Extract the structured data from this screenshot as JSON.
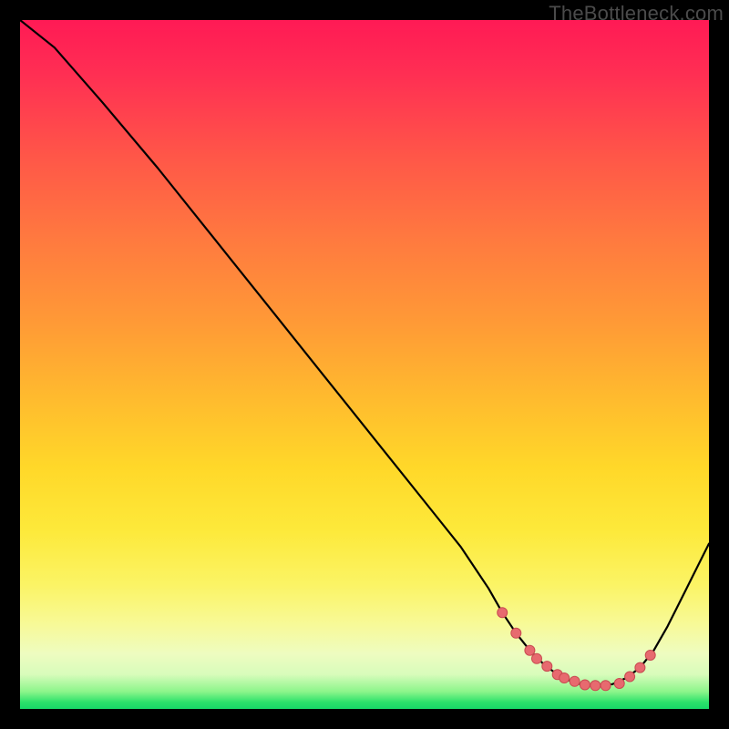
{
  "watermark": "TheBottleneck.com",
  "colors": {
    "curve": "#000000",
    "marker_fill": "#e76a6f",
    "marker_stroke": "#c94b51"
  },
  "chart_data": {
    "type": "line",
    "title": "",
    "xlabel": "",
    "ylabel": "",
    "xlim": [
      0,
      100
    ],
    "ylim": [
      0,
      100
    ],
    "grid": false,
    "legend": false,
    "series": [
      {
        "name": "curve",
        "x": [
          0,
          5,
          12,
          20,
          28,
          36,
          44,
          52,
          60,
          64,
          68,
          70,
          72,
          74,
          76,
          78,
          80,
          82,
          84,
          86,
          88,
          90,
          92,
          94,
          96,
          100
        ],
        "y": [
          100,
          96,
          88,
          78.5,
          68.5,
          58.5,
          48.5,
          38.5,
          28.5,
          23.5,
          17.5,
          14,
          11,
          8.5,
          6.5,
          5,
          4,
          3.4,
          3.4,
          3.6,
          4.5,
          6,
          8.5,
          12,
          16,
          24
        ]
      }
    ],
    "markers": {
      "name": "highlight-points",
      "x": [
        70,
        72,
        74,
        75,
        76.5,
        78,
        79,
        80.5,
        82,
        83.5,
        85,
        87,
        88.5,
        90,
        91.5
      ],
      "y": [
        14,
        11,
        8.5,
        7.3,
        6.2,
        5,
        4.5,
        4,
        3.5,
        3.4,
        3.4,
        3.7,
        4.7,
        6,
        7.8
      ]
    }
  }
}
